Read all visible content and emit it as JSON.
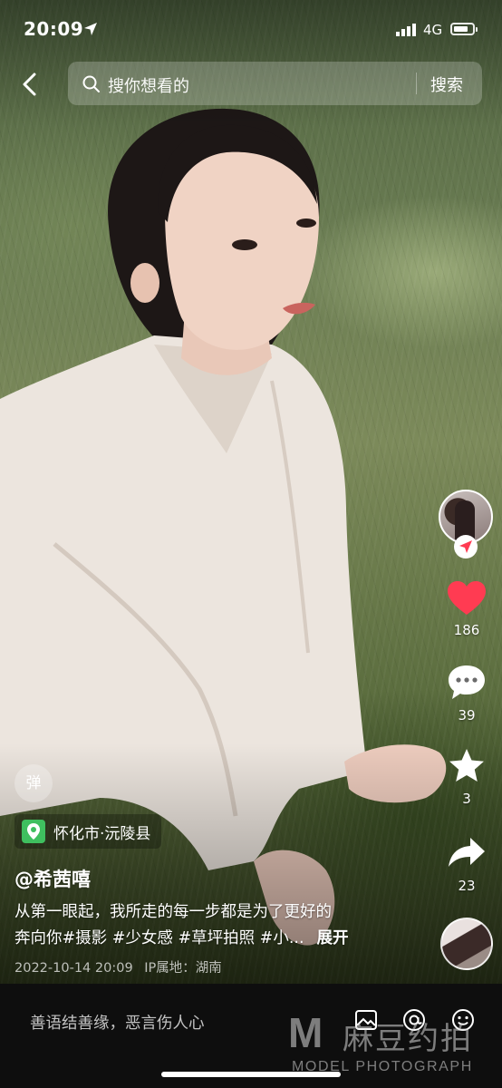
{
  "status_bar": {
    "time": "20:09",
    "network": "4G",
    "battery_level": 0.7
  },
  "search": {
    "placeholder": "搜你想看的",
    "button_label": "搜索"
  },
  "actions": {
    "likes": "186",
    "comments": "39",
    "favorites": "3",
    "shares": "23",
    "like_color": "#ff3b52"
  },
  "post": {
    "danmu_label": "弹",
    "location": "怀化市·沅陵县",
    "username": "@希茜嘻",
    "caption_line1": "从第一眼起，我所走的每一步都是为了更好的",
    "caption_line2": "奔向你#摄影 #少女感 #草坪拍照 #小...",
    "expand_label": "展开",
    "datetime": "2022-10-14 20:09",
    "ip_location": "IP属地：湖南"
  },
  "comment_bar": {
    "placeholder": "善语结善缘，恶言伤人心"
  },
  "watermark": {
    "mark": "M",
    "text_cn": "麻豆约拍",
    "text_en": "MODEL PHOTOGRAPH"
  }
}
